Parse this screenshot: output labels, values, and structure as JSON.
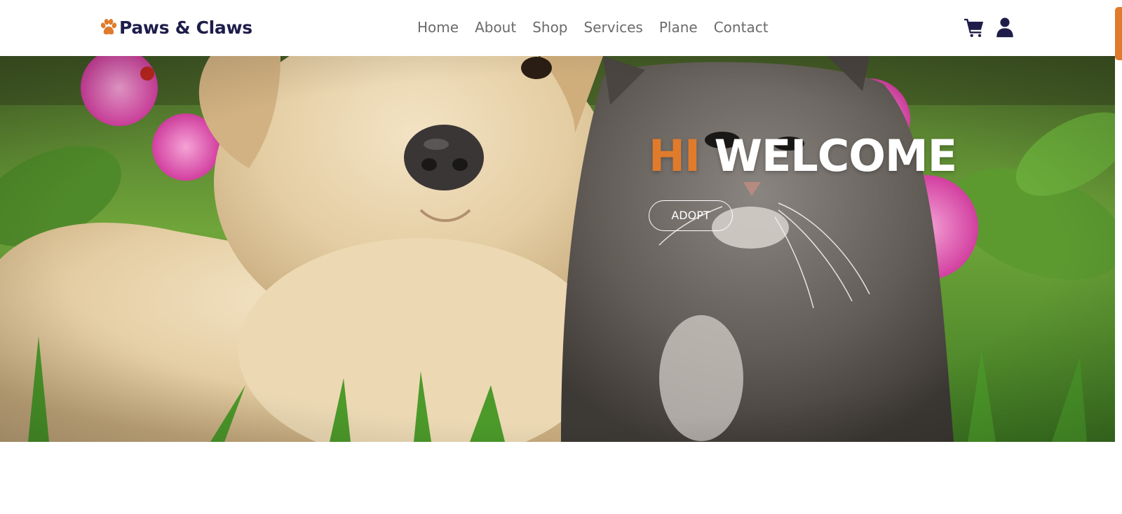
{
  "brand": {
    "name": "Paws & Claws",
    "icon": "paw-icon",
    "accent_color": "#e07b2c",
    "text_color": "#1e1d4a"
  },
  "nav": {
    "links": [
      {
        "label": "Home"
      },
      {
        "label": "About"
      },
      {
        "label": "Shop"
      },
      {
        "label": "Services"
      },
      {
        "label": "Plane"
      },
      {
        "label": "Contact"
      }
    ],
    "icons": [
      {
        "name": "cart-icon"
      },
      {
        "name": "user-icon"
      }
    ]
  },
  "hero": {
    "title_accent": "HI",
    "title_main": "WELCOME",
    "button_label": "ADOPT",
    "image": "puppy-and-kitten-photo",
    "accent_color": "#e07b2c"
  }
}
